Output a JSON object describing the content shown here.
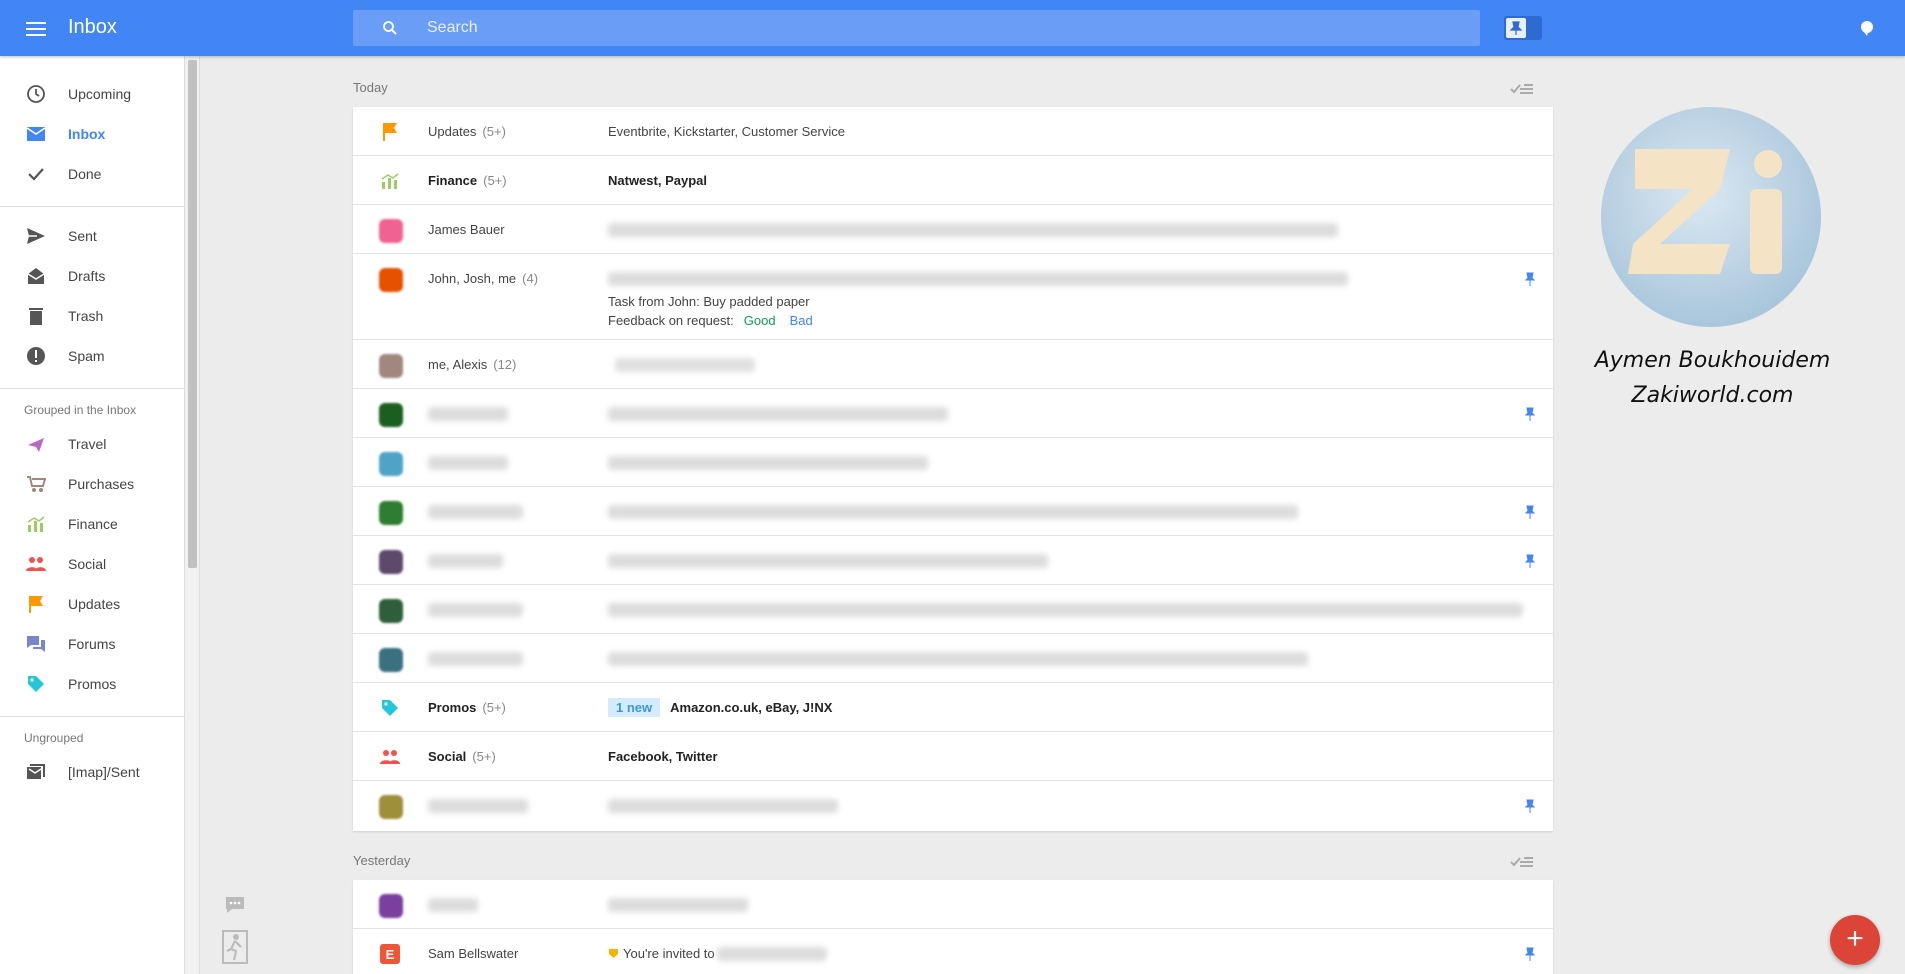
{
  "header": {
    "title": "Inbox",
    "search_placeholder": "Search"
  },
  "sidebar": {
    "items": [
      {
        "label": "Upcoming",
        "icon": "clock-icon"
      },
      {
        "label": "Inbox",
        "icon": "mail-icon"
      },
      {
        "label": "Done",
        "icon": "check-icon"
      },
      {
        "label": "Sent",
        "icon": "send-icon"
      },
      {
        "label": "Drafts",
        "icon": "drafts-icon"
      },
      {
        "label": "Trash",
        "icon": "trash-icon"
      },
      {
        "label": "Spam",
        "icon": "spam-icon"
      }
    ],
    "grouped_label": "Grouped in the Inbox",
    "groups": [
      {
        "label": "Travel",
        "icon": "plane-icon",
        "color": "#ba68c8"
      },
      {
        "label": "Purchases",
        "icon": "cart-icon",
        "color": "#a1887f"
      },
      {
        "label": "Finance",
        "icon": "chart-icon",
        "color": "#9ccc65"
      },
      {
        "label": "Social",
        "icon": "people-icon",
        "color": "#ef5350"
      },
      {
        "label": "Updates",
        "icon": "flag-icon",
        "color": "#ff9800"
      },
      {
        "label": "Forums",
        "icon": "forum-icon",
        "color": "#7986cb"
      },
      {
        "label": "Promos",
        "icon": "tag-icon",
        "color": "#26c6da"
      }
    ],
    "ungrouped_label": "Ungrouped",
    "ungrouped": [
      {
        "label": "[Imap]/Sent",
        "icon": "label-icon"
      }
    ]
  },
  "today": {
    "label": "Today",
    "rows": {
      "updates": {
        "sender": "Updates",
        "count": "(5+)",
        "subject": "Eventbrite, Kickstarter, Customer Service"
      },
      "finance": {
        "sender": "Finance",
        "count": "(5+)",
        "subject": "Natwest, Paypal"
      },
      "james": {
        "sender": "James Bauer"
      },
      "john": {
        "sender": "John, Josh, me",
        "count": "(4)",
        "task": "Task from John: Buy padded paper",
        "feedback": "Feedback on request:",
        "good": "Good",
        "bad": "Bad"
      },
      "alexis": {
        "sender": "me, Alexis",
        "count": "(12)"
      },
      "promos": {
        "sender": "Promos",
        "count": "(5+)",
        "badge": "1 new",
        "subject": "Amazon.co.uk, eBay, J!NX"
      },
      "social": {
        "sender": "Social",
        "count": "(5+)",
        "subject": "Facebook, Twitter"
      }
    }
  },
  "yesterday": {
    "label": "Yesterday",
    "rows": {
      "sam": {
        "sender": "Sam Bellswater",
        "subject": "You're invited to"
      }
    }
  },
  "watermark": {
    "line1": "Aymen Boukhouidem",
    "line2": "Zakiworld.com"
  },
  "colors": {
    "brand": "#4285f4",
    "fab": "#db4437"
  }
}
